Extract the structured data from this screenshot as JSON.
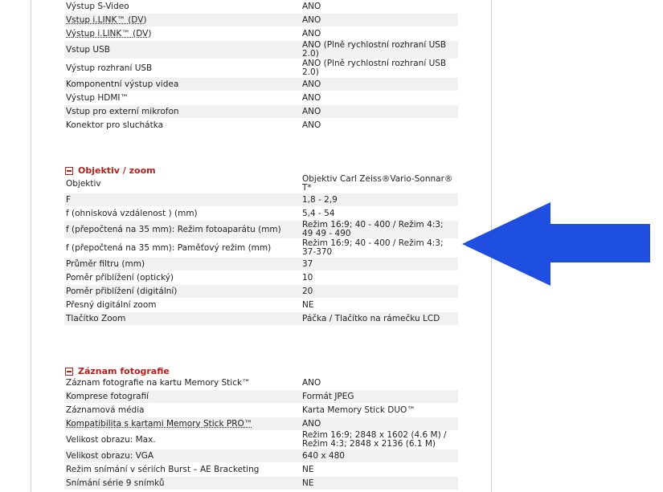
{
  "connectivity": [
    {
      "k": "Výstup S-Video",
      "v": "ANO"
    },
    {
      "k": "Vstup i.LINK™ (DV)",
      "v": "ANO",
      "underline": true
    },
    {
      "k": "Výstup i.LINK™ (DV)",
      "v": "ANO",
      "underline": true
    },
    {
      "k": "Vstup USB",
      "v": "ANO (Plně rychlostní rozhraní USB 2.0)"
    },
    {
      "k": "Výstup rozhraní USB",
      "v": "ANO (Plně rychlostní rozhraní USB 2.0)"
    },
    {
      "k": "Komponentní výstup videa",
      "v": "ANO"
    },
    {
      "k": "Výstup HDMI™",
      "v": "ANO"
    },
    {
      "k": "Vstup pro externí mikrofon",
      "v": "ANO"
    },
    {
      "k": "Konektor pro sluchátka",
      "v": "ANO"
    }
  ],
  "lens": {
    "title": "Objektiv / zoom",
    "rows": [
      {
        "k": "Objektiv",
        "v": "Objektiv Carl Zeiss®Vario-Sonnar® T*"
      },
      {
        "k": "F",
        "v": "1,8 - 2,9"
      },
      {
        "k": "f (ohnisková vzdálenost ) (mm)",
        "v": "5,4 - 54"
      },
      {
        "k": "f (přepočtená na 35 mm): Režim fotoaparátu (mm)",
        "v": "Režim 16:9; 40 - 400 / Režim 4:3; 49 49 - 490"
      },
      {
        "k": "f (přepočtená na 35 mm): Paměťový režim (mm)",
        "v": "Režim 16:9; 40 - 400 / Režim 4:3; 37-370"
      },
      {
        "k": "Průměr filtru (mm)",
        "v": "37"
      },
      {
        "k": "Poměr přiblížení (optický)",
        "v": "10"
      },
      {
        "k": "Poměr přiblížení (digitální)",
        "v": "20"
      },
      {
        "k": "Přesný digitální zoom",
        "v": "NE"
      },
      {
        "k": "Tlačítko Zoom",
        "v": "Páčka / Tlačítko na rámečku LCD"
      }
    ]
  },
  "photo": {
    "title": "Záznam fotografie",
    "rows": [
      {
        "k": "Záznam fotografie na kartu Memory Stick™",
        "v": "ANO"
      },
      {
        "k": "Komprese fotografií",
        "v": "Formát JPEG"
      },
      {
        "k": "Záznamová média",
        "v": "Karta Memory Stick DUO™"
      },
      {
        "k": "Kompatibilita s kartami Memory Stick PRO™",
        "v": "ANO",
        "underline": true
      },
      {
        "k": "Velikost obrazu: Max.",
        "v": "Režim 16:9; 2848 x 1602 (4.6 M) / Režim 4:3; 2848 x 2136 (6.1 M)"
      },
      {
        "k": "Velikost obrazu: VGA",
        "v": "640 x 480"
      },
      {
        "k": "Režim snímání v sériích Burst – AE Bracketing",
        "v": "NE"
      },
      {
        "k": "Snímání série 9 snímků",
        "v": "NE"
      }
    ]
  },
  "colors": {
    "accent": "#b3211b",
    "arrow": "#1f4fe0"
  }
}
